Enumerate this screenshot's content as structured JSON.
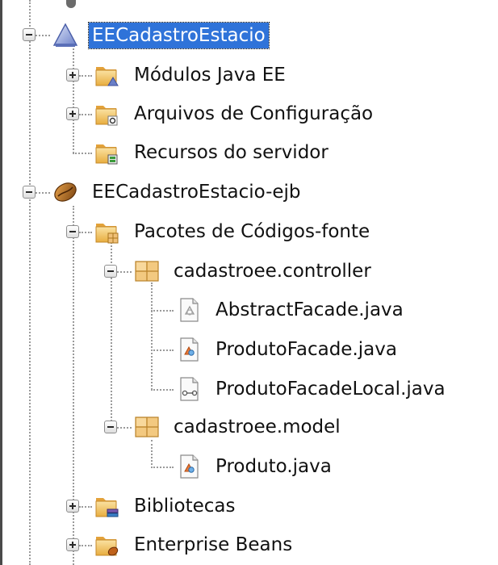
{
  "tree": {
    "nodes": [
      {
        "label": "EECadastroEstacio",
        "icon": "enterprise-app-icon",
        "selected": true
      },
      {
        "label": "Módulos Java EE",
        "icon": "java-ee-modules-folder-icon"
      },
      {
        "label": "Arquivos de Configuração",
        "icon": "config-files-folder-icon"
      },
      {
        "label": "Recursos do servidor",
        "icon": "server-resources-folder-icon"
      },
      {
        "label": "EECadastroEstacio-ejb",
        "icon": "ejb-module-bean-icon"
      },
      {
        "label": "Pacotes de Códigos-fonte",
        "icon": "source-packages-folder-icon"
      },
      {
        "label": "cadastroee.controller",
        "icon": "package-icon"
      },
      {
        "label": "AbstractFacade.java",
        "icon": "abstract-class-file-icon"
      },
      {
        "label": "ProdutoFacade.java",
        "icon": "class-file-icon"
      },
      {
        "label": "ProdutoFacadeLocal.java",
        "icon": "interface-file-icon"
      },
      {
        "label": "cadastroee.model",
        "icon": "package-icon"
      },
      {
        "label": "Produto.java",
        "icon": "class-file-icon"
      },
      {
        "label": "Bibliotecas",
        "icon": "libraries-folder-icon"
      },
      {
        "label": "Enterprise Beans",
        "icon": "enterprise-beans-folder-icon"
      }
    ]
  },
  "colors": {
    "selection": "#2f73d9",
    "folder": "#f3c76a",
    "package": "#f0c078"
  }
}
